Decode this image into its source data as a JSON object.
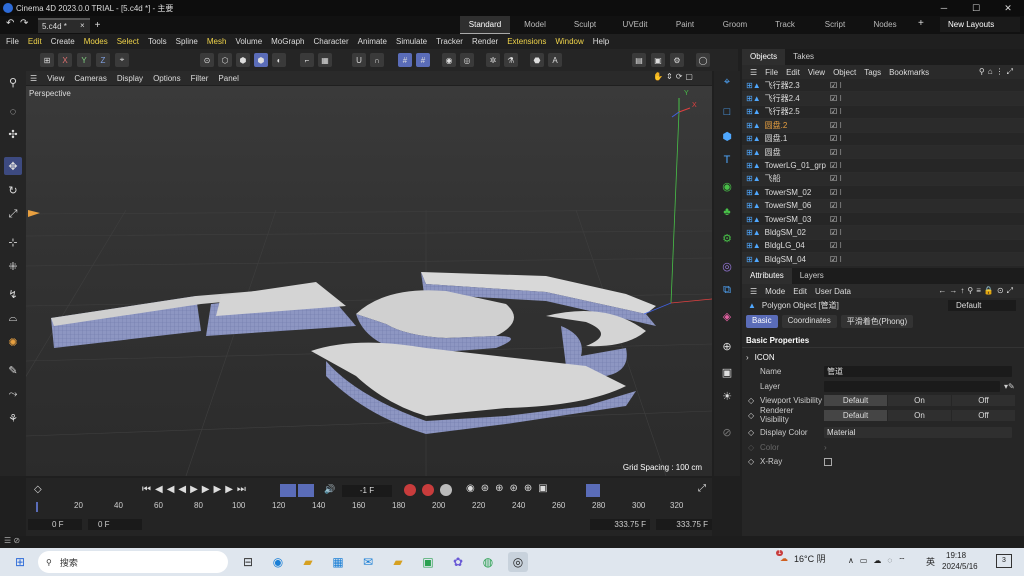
{
  "window": {
    "title": "Cinema 4D 2023.0.0 TRIAL - [5.c4d *] - 主要"
  },
  "tabs": {
    "doc": "5.c4d *",
    "close": "×",
    "add": "+"
  },
  "layouts": [
    "Standard",
    "Model",
    "Sculpt",
    "UVEdit",
    "Paint",
    "Groom",
    "Track",
    "Script",
    "Nodes"
  ],
  "new_layouts": "New Layouts",
  "menu": [
    "File",
    "Edit",
    "Create",
    "Modes",
    "Select",
    "Tools",
    "Spline",
    "Mesh",
    "Volume",
    "MoGraph",
    "Character",
    "Animate",
    "Simulate",
    "Tracker",
    "Render",
    "Extensions",
    "Window",
    "Help"
  ],
  "axes_locks": [
    "X",
    "Y",
    "Z"
  ],
  "viewport": {
    "menu": [
      "View",
      "Cameras",
      "Display",
      "Options",
      "Filter",
      "Panel"
    ],
    "label": "Perspective",
    "grid_spacing": "Grid Spacing : 100 cm",
    "axis_y": "Y",
    "axis_x": "X"
  },
  "timeline": {
    "frame_display": "-1 F",
    "ticks": [
      "0",
      "20",
      "40",
      "60",
      "80",
      "100",
      "120",
      "140",
      "160",
      "180",
      "200",
      "220",
      "240",
      "260",
      "280",
      "300",
      "320"
    ],
    "start": "0 F",
    "current": "0 F",
    "end1": "333.75 F",
    "end2": "333.75 F"
  },
  "objects_panel": {
    "tabs": [
      "Objects",
      "Takes"
    ],
    "menu": [
      "File",
      "Edit",
      "View",
      "Object",
      "Tags",
      "Bookmarks"
    ],
    "items": [
      "飞行器2.3",
      "飞行器2.4",
      "飞行器2.5",
      "圆盘.2",
      "圆盘.1",
      "圆盘",
      "TowerLG_01_grp",
      "飞船",
      "TowerSM_02",
      "TowerSM_06",
      "TowerSM_03",
      "BldgSM_02",
      "BldgLG_04",
      "BldgSM_04"
    ]
  },
  "attributes_panel": {
    "tabs": [
      "Attributes",
      "Layers"
    ],
    "menu": [
      "Mode",
      "Edit",
      "User Data"
    ],
    "object_title": "Polygon Object [管道]",
    "preset": "Default",
    "subtabs": [
      "Basic",
      "Coordinates",
      "平滑着色(Phong)"
    ],
    "section": "Basic Properties",
    "group": "ICON",
    "rows": {
      "name_label": "Name",
      "name_value": "管道",
      "layer_label": "Layer",
      "viewport_label": "Viewport Visibility",
      "renderer_label": "Renderer Visibility",
      "vis_options": [
        "Default",
        "On",
        "Off"
      ],
      "display_color_label": "Display Color",
      "display_color_value": "Material",
      "color_label": "Color",
      "xray_label": "X-Ray"
    }
  },
  "taskbar": {
    "search": "搜索",
    "weather_temp": "16°C 阴",
    "weather_badge": "1",
    "ime": "英",
    "time": "19:18",
    "date": "2024/5/16",
    "notif": "3"
  },
  "colors": {
    "accent": "#5a6cb8",
    "highlight_orange": "#e8a040",
    "menu_yellow": "#f0d44a"
  }
}
